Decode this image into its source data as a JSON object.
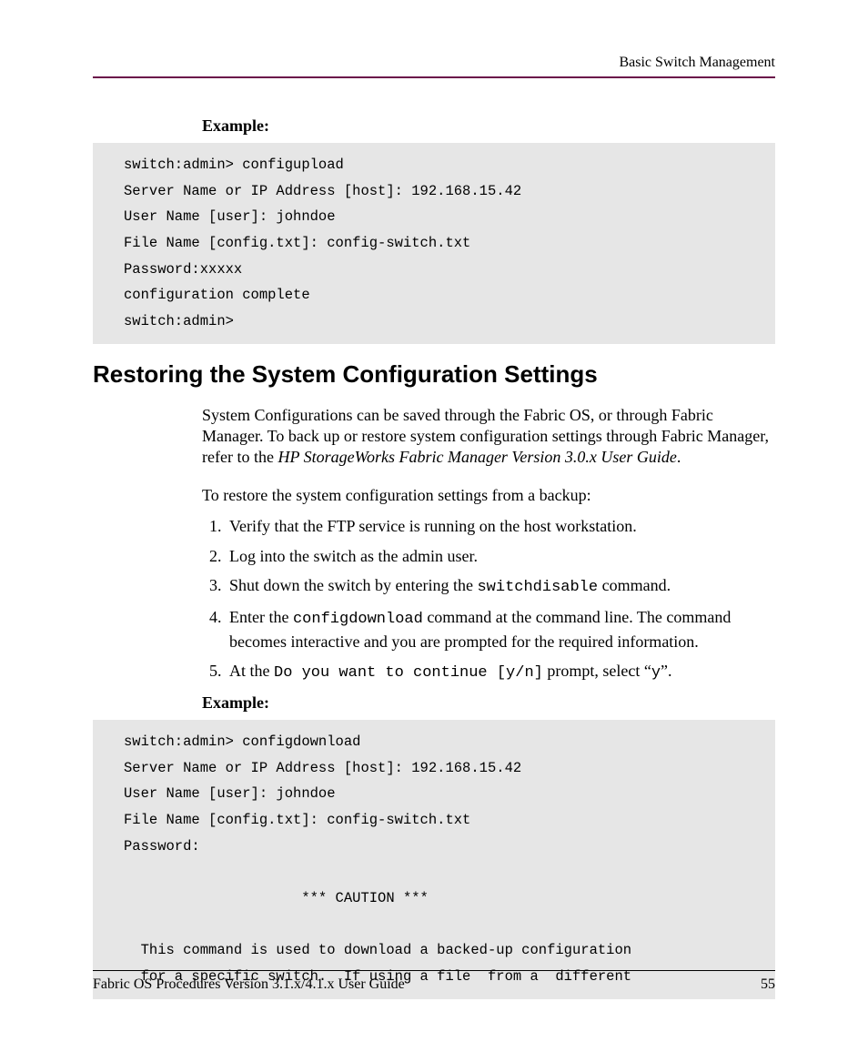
{
  "header": {
    "right_text": "Basic Switch Management"
  },
  "example1": {
    "label": "Example:",
    "code": "switch:admin> configupload\nServer Name or IP Address [host]: 192.168.15.42\nUser Name [user]: johndoe\nFile Name [config.txt]: config-switch.txt\nPassword:xxxxx\nconfiguration complete\nswitch:admin>"
  },
  "section": {
    "heading": "Restoring the System Configuration Settings",
    "para1_a": "System Configurations can be saved through the Fabric OS, or through Fabric Manager. To back up or restore system configuration settings through Fabric Manager, refer to the ",
    "para1_italic": "HP StorageWorks Fabric Manager Version 3.0.x User Guide",
    "para1_b": ".",
    "para2": "To restore the system configuration settings from a backup:",
    "steps": {
      "s1": "Verify that the FTP service is running on the host workstation.",
      "s2": "Log into the switch as the admin user.",
      "s3_a": "Shut down the switch by entering the ",
      "s3_cmd": "switchdisable",
      "s3_b": " command.",
      "s4_a": "Enter the ",
      "s4_cmd": "configdownload",
      "s4_b": " command at the command line. The command becomes interactive and you are prompted for the required information.",
      "s5_a": "At the ",
      "s5_cmd": "Do you want to continue [y/n]",
      "s5_b": " prompt, select “",
      "s5_y": "y",
      "s5_c": "”."
    }
  },
  "example2": {
    "label": "Example:",
    "code": "switch:admin> configdownload\nServer Name or IP Address [host]: 192.168.15.42\nUser Name [user]: johndoe\nFile Name [config.txt]: config-switch.txt\nPassword:\n\n                     *** CAUTION ***\n\n  This command is used to download a backed-up configuration\n  for a specific switch.  If using a file  from a  different"
  },
  "footer": {
    "left": "Fabric OS Procedures Version 3.1.x/4.1.x User Guide",
    "right": "55"
  }
}
